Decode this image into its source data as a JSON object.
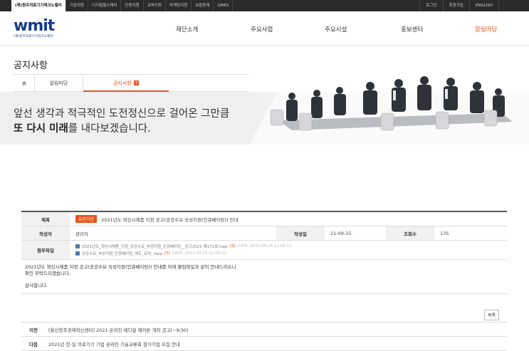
{
  "topbar": {
    "links": [
      "(재)원주의료기기테크노밸리",
      "기업지원",
      "디지털헬스케어",
      "인증지원",
      "교육지원",
      "마케팅지원",
      "보험등재",
      "GMES"
    ],
    "right": [
      "로그인",
      "회원가입",
      "ENGLISH"
    ]
  },
  "header": {
    "logo_text": "wmit",
    "logo_sub": "(재)원주의료기기테크노밸리",
    "nav": [
      "재단소개",
      "주요사업",
      "주요시설",
      "홍보센터",
      "알림마당"
    ]
  },
  "page": {
    "title": "공지사항",
    "crumb_parent": "알림마당",
    "crumb_current": "공지사항",
    "crumb_plus": "+"
  },
  "banner": {
    "line1": "앞선 생각과 적극적인 도전정신으로 걸어온 그만큼",
    "line2_bold": "또 다시 미래",
    "line2_rest": "를 내다보겠습니다."
  },
  "post": {
    "labels": {
      "title": "제목",
      "author": "작성자",
      "date": "작성일",
      "views": "조회수",
      "files": "첨부파일"
    },
    "category": "유관기관",
    "title": "2021년도 혁신시제품 지정 공고(공공수요 숙성지원(인큐베이팅)) 안내",
    "author": "관리자",
    "date": "21-09-15",
    "views": "135",
    "files": [
      {
        "name": "2021년도_혁신시제품_지정_공공수요_숙성지원_인큐베이팅__공고2021-제171호.hwp",
        "count": "[4]",
        "date": "DATE: 2021-09-15 11:06:12"
      },
      {
        "name": "공공수요_숙성지원_인큐베이팅_계도_요약_.hwp",
        "count": "[0]",
        "date": "DATE: 2021-09-15 11:06:12"
      }
    ],
    "body_line1": "2021년도 혁신시제품 지정 공고(공공수요 숙성지원(인큐베이팅)) 안내를 아래 붙임파일과 같이 안내드리오니",
    "body_line2": "확인 부탁드리겠습니다.",
    "body_line3": "감사합니다."
  },
  "list_button": "목록",
  "prevnext": {
    "prev_label": "이전",
    "prev_title": "[울산창조경제혁신센터] 2021 온라인 메디컬 해커톤 개최 공고(~9/30)",
    "next_label": "다음",
    "next_title": "2021년 한-일 의료기기 기업 온라인 기술교류회 참가기업 모집 안내"
  }
}
